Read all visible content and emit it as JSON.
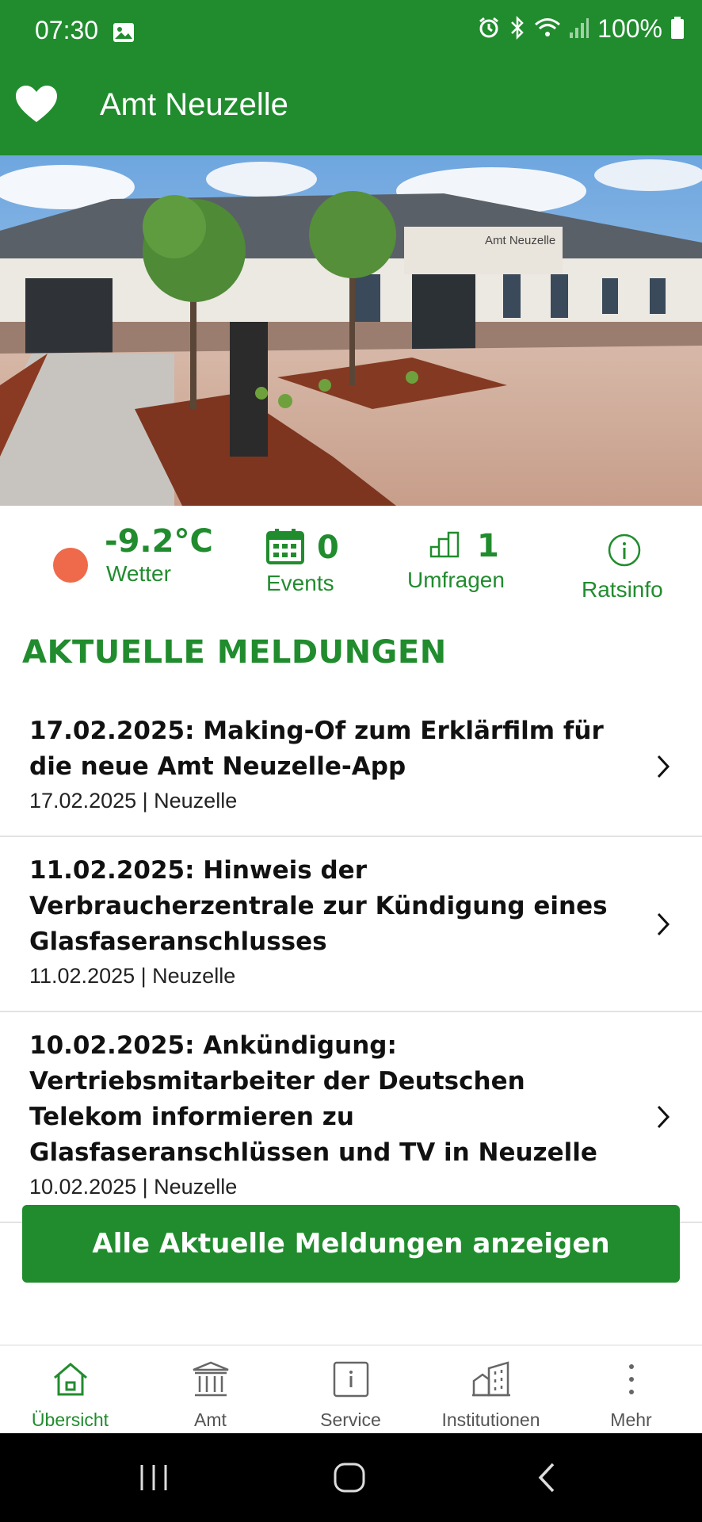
{
  "status_bar": {
    "time": "07:30",
    "battery": "100%"
  },
  "app_bar": {
    "title": "Amt Neuzelle"
  },
  "hero": {
    "sign_text": "Amt Neuzelle"
  },
  "quick_info": [
    {
      "value": "-9.2°C",
      "label": "Wetter"
    },
    {
      "value": "0",
      "label": "Events"
    },
    {
      "value": "1",
      "label": "Umfragen"
    },
    {
      "value": "",
      "label": "Ratsinfo"
    }
  ],
  "news": {
    "section_title": "AKTUELLE MELDUNGEN",
    "items": [
      {
        "title": "17.02.2025: Making-Of zum Erklärfilm für die neue Amt Neuzelle-App",
        "meta": "17.02.2025 | Neuzelle"
      },
      {
        "title": "11.02.2025: Hinweis der Verbraucherzentrale zur Kündigung eines Glasfaseranschlusses",
        "meta": "11.02.2025 | Neuzelle"
      },
      {
        "title": "10.02.2025: Ankündigung: Vertriebsmitarbeiter der Deutschen Telekom informieren zu Glasfaseranschlüssen und TV in Neuzelle",
        "meta": "10.02.2025 | Neuzelle"
      }
    ],
    "all_button": "Alle Aktuelle Meldungen anzeigen"
  },
  "bottom_nav": [
    {
      "label": "Übersicht",
      "icon": "home-icon",
      "active": true
    },
    {
      "label": "Amt",
      "icon": "building-columns-icon"
    },
    {
      "label": "Service",
      "icon": "info-box-icon"
    },
    {
      "label": "Institutionen",
      "icon": "buildings-icon"
    },
    {
      "label": "Mehr",
      "icon": "more-vertical-icon"
    }
  ],
  "colors": {
    "primary": "#218c2e",
    "weather_dot": "#ef6a4a"
  }
}
